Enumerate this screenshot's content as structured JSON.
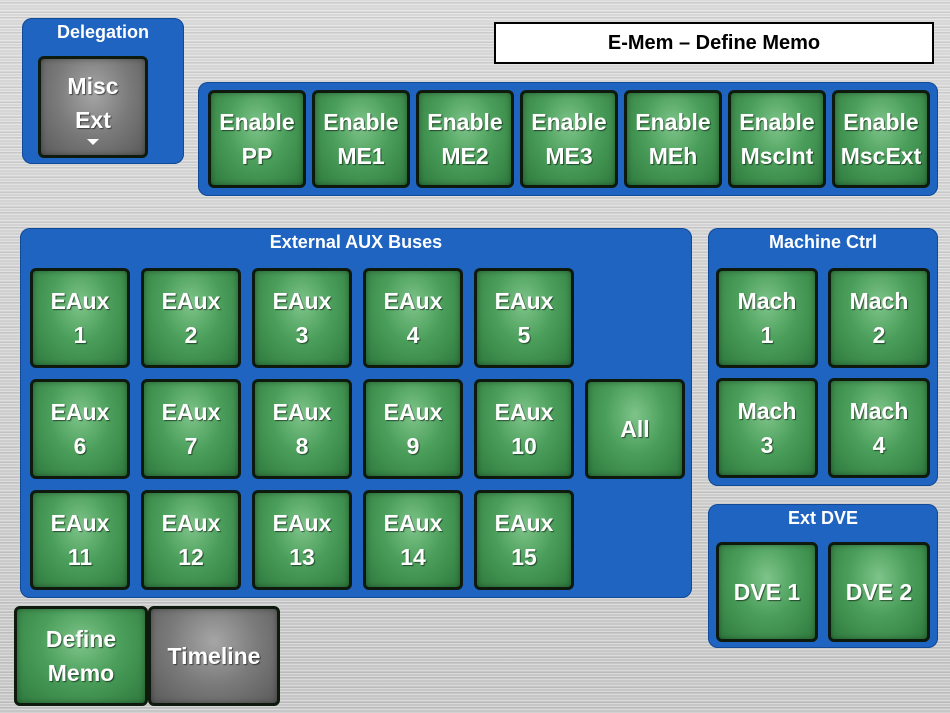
{
  "title": "E-Mem – Define Memo",
  "delegation": {
    "title": "Delegation",
    "button": {
      "line1": "Misc",
      "line2": "Ext",
      "icon": "caret-down-icon"
    }
  },
  "enable_buttons": [
    {
      "line1": "Enable",
      "line2": "PP"
    },
    {
      "line1": "Enable",
      "line2": "ME1"
    },
    {
      "line1": "Enable",
      "line2": "ME2"
    },
    {
      "line1": "Enable",
      "line2": "ME3"
    },
    {
      "line1": "Enable",
      "line2": "MEh"
    },
    {
      "line1": "Enable",
      "line2": "MscInt"
    },
    {
      "line1": "Enable",
      "line2": "MscExt"
    }
  ],
  "aux": {
    "title": "External AUX Buses",
    "buttons": [
      {
        "line1": "EAux",
        "line2": "1"
      },
      {
        "line1": "EAux",
        "line2": "2"
      },
      {
        "line1": "EAux",
        "line2": "3"
      },
      {
        "line1": "EAux",
        "line2": "4"
      },
      {
        "line1": "EAux",
        "line2": "5"
      },
      {
        "line1": "EAux",
        "line2": "6"
      },
      {
        "line1": "EAux",
        "line2": "7"
      },
      {
        "line1": "EAux",
        "line2": "8"
      },
      {
        "line1": "EAux",
        "line2": "9"
      },
      {
        "line1": "EAux",
        "line2": "10"
      },
      {
        "line1": "EAux",
        "line2": "11"
      },
      {
        "line1": "EAux",
        "line2": "12"
      },
      {
        "line1": "EAux",
        "line2": "13"
      },
      {
        "line1": "EAux",
        "line2": "14"
      },
      {
        "line1": "EAux",
        "line2": "15"
      }
    ],
    "all_label": "All"
  },
  "machine": {
    "title": "Machine Ctrl",
    "buttons": [
      {
        "line1": "Mach",
        "line2": "1"
      },
      {
        "line1": "Mach",
        "line2": "2"
      },
      {
        "line1": "Mach",
        "line2": "3"
      },
      {
        "line1": "Mach",
        "line2": "4"
      }
    ]
  },
  "dve": {
    "title": "Ext DVE",
    "buttons": [
      {
        "label": "DVE 1"
      },
      {
        "label": "DVE 2"
      }
    ]
  },
  "bottom_tabs": [
    {
      "line1": "Define",
      "line2": "Memo"
    },
    {
      "line1": "Timeline"
    }
  ],
  "colors": {
    "panel_blue": "#1f64c0",
    "button_green": "#4a9e5a",
    "button_gray": "#7a7a7a"
  }
}
